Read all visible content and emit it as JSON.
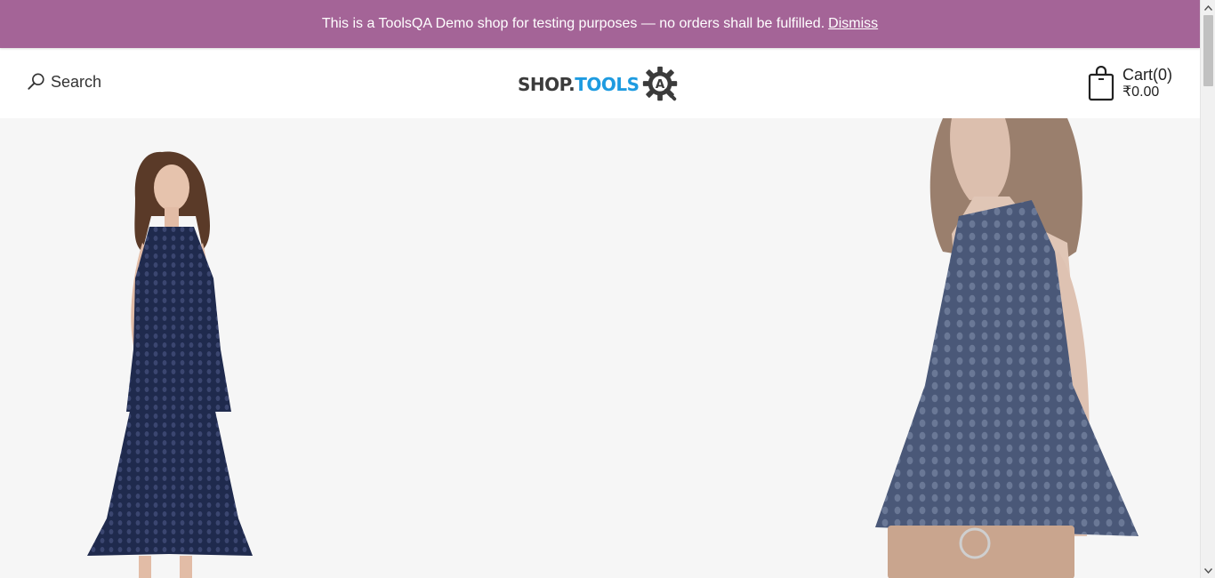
{
  "notice": {
    "message": "This is a ToolsQA Demo shop for testing purposes — no orders shall be fulfilled.",
    "dismiss_label": "Dismiss"
  },
  "header": {
    "search_label": "Search",
    "search_icon": "search-icon",
    "logo": {
      "part1": "SHOP.",
      "part2": "TOOLS",
      "mark": "A"
    },
    "cart": {
      "label": "Cart(0)",
      "total": "₹0.00",
      "icon": "shopping-bag-icon"
    }
  },
  "hero": {
    "images": [
      "model-left-dress",
      "model-right-top"
    ]
  },
  "colors": {
    "notice_bg": "#a46497",
    "logo_dark": "#3b3b3b",
    "logo_blue": "#1e9be0",
    "hero_bg": "#f6f6f6",
    "dress_navy": "#1f2a4d"
  }
}
